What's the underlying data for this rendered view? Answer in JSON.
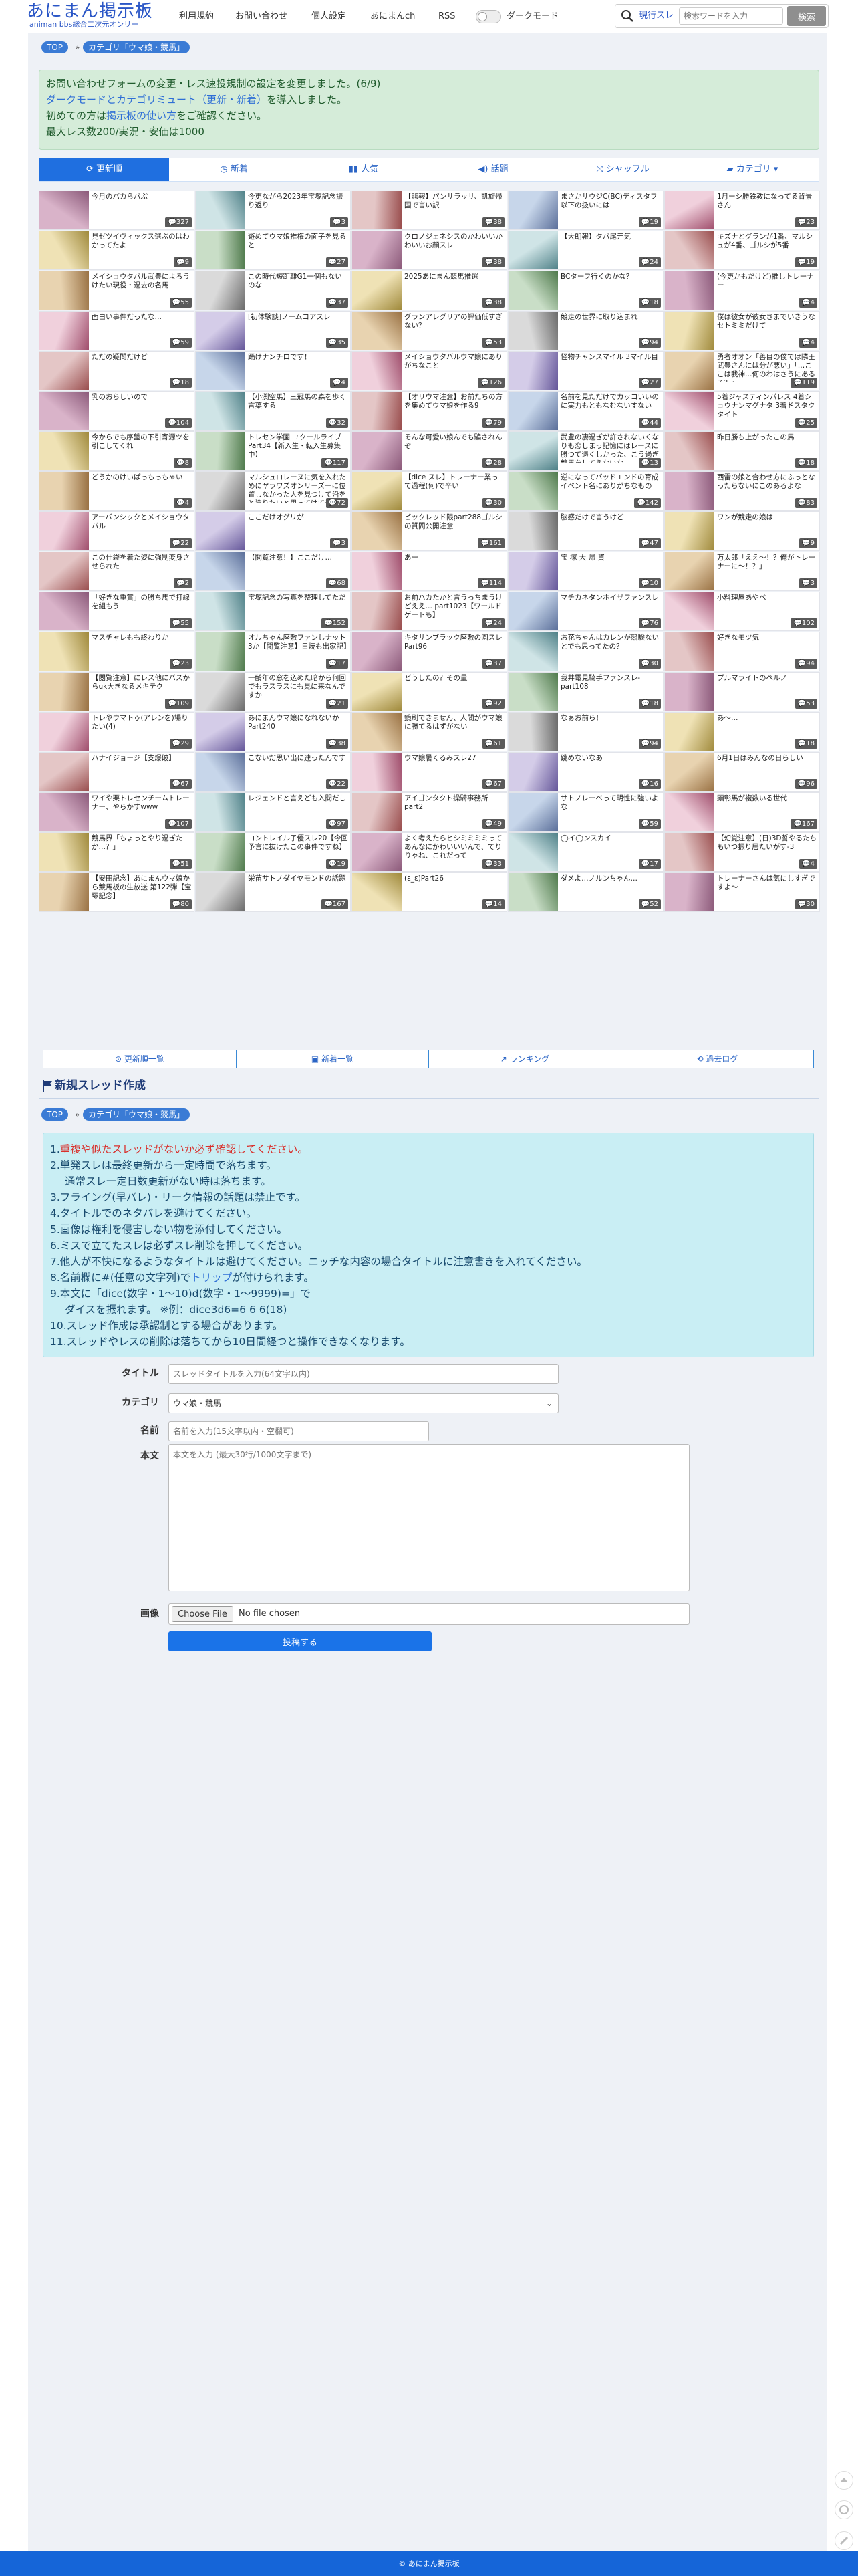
{
  "header": {
    "logo": "あにまん掲示板",
    "logo_sub": "animan bbs総合二次元オンリー",
    "nav": [
      "利用規約",
      "お問い合わせ",
      "個人設定",
      "あにまんch",
      "RSS"
    ],
    "dark_mode_label": "ダークモード",
    "search_mode": "現行スレ",
    "search_placeholder": "検索ワードを入力",
    "search_button": "検索"
  },
  "breadcrumb": {
    "top": "TOP",
    "category": "カテゴリ「ウマ娘・競馬」"
  },
  "notice": {
    "line1": "お問い合わせフォームの変更・レス速投規制の設定を変更しました。(6/9)",
    "line2_link": "ダークモードとカテゴリミュート（更新・新着）",
    "line2_tail": "を導入しました。",
    "line3_head": "初めての方は",
    "line3_link": "掲示板の使い方",
    "line3_tail": "をご確認ください。",
    "line4": "最大レス数200/実況・安価は1000"
  },
  "tabs": [
    "更新順",
    "新着",
    "人気",
    "話題",
    "シャッフル",
    "カテゴリ"
  ],
  "threads": [
    {
      "t": "今月のバカらバぷ",
      "n": "327"
    },
    {
      "t": "今更ながら2023年宝塚記念振り返り",
      "n": "3"
    },
    {
      "t": "【悲報】パンサラッサ、凱旋帰国で言い訳",
      "n": "38"
    },
    {
      "t": "まさかサウジC(BC)ディスタフ以下の扱いには",
      "n": "19"
    },
    {
      "t": "1月ーシ勝鉄教になってる背景さん",
      "n": "23"
    },
    {
      "t": "見ゼツイヴィックス選ぶのはわかってたよ",
      "n": "9"
    },
    {
      "t": "遊めてウマ娘推権の面子を見ると",
      "n": "27"
    },
    {
      "t": "クロノジェネシスのかわいいかわいいお顔スレ",
      "n": "38"
    },
    {
      "t": "【大朗報】タバ尾元気",
      "n": "24"
    },
    {
      "t": "キズナとグランが1番、マルシュが4番、ゴルシが5番",
      "n": "19"
    },
    {
      "t": "メイショウタバル武豊によろうけたい現役・過去の名馬",
      "n": "55"
    },
    {
      "t": "この時代短距離G1一個もないのな",
      "n": "37"
    },
    {
      "t": "2025あにまん競馬推選",
      "n": "38"
    },
    {
      "t": "BCターフ行くのかな？",
      "n": "18"
    },
    {
      "t": "(今更かもだけど)推しトレーナー",
      "n": "4"
    },
    {
      "t": "面白い事件だったな…",
      "n": "59"
    },
    {
      "t": "[初体験談]ノームコアスレ",
      "n": "35"
    },
    {
      "t": "グランアレグリアの評価低すぎない？",
      "n": "53"
    },
    {
      "t": "競走の世界に取り込まれ",
      "n": "94"
    },
    {
      "t": "僕は彼女が彼女さまでいきうなセトミミだけて",
      "n": "4"
    },
    {
      "t": "ただの疑問だけど",
      "n": "18"
    },
    {
      "t": "踊けナンチロです！",
      "n": "4"
    },
    {
      "t": "メイショウタバルウマ娘にありがちなこと",
      "n": "126"
    },
    {
      "t": "怪物チャンスマイル 3マイル目",
      "n": "27"
    },
    {
      "t": "勇者オオン「善目の僕では隣王武豊さんには分が悪い」「…ここは我神…何のわはさうにあるる？」",
      "n": "119"
    },
    {
      "t": "乳のおらしいので",
      "n": "104"
    },
    {
      "t": "【小渕空馬】三冠馬の森を歩く言葉する",
      "n": "32"
    },
    {
      "t": "【オリウマ注意】お前たちの方を集めてウマ娘を作る9",
      "n": "79"
    },
    {
      "t": "名前を見ただけでカッコいいのに実力もともなむないすない",
      "n": "44"
    },
    {
      "t": "5着ジャスティンパレス 4着ショウナンマグナタ 3着ドスタクタイト",
      "n": "25"
    },
    {
      "t": "今からでも序盤の下引寄源ツを引こしてくれ",
      "n": "8"
    },
    {
      "t": "トレセン学園 ユクールライブPart34【新入生・転入生募集中】",
      "n": "117"
    },
    {
      "t": "そんな可愛い娘んでも騙されんぞ",
      "n": "28"
    },
    {
      "t": "武豊の凄過ぎが許されないくなりも恋しまっ記憶にはレースに勝つて退くしかった、こう過ぎ競馬をしてえないな",
      "n": "13"
    },
    {
      "t": "昨日勝ち上がったこの馬",
      "n": "18"
    },
    {
      "t": "どうかのけいぱっちっちゃい",
      "n": "4"
    },
    {
      "t": "マルシュロレーヌに気を入れためにヤラワズオンリーズーに位置しなかった人を見つけて沿をと塗りたいと思ってけてきた",
      "n": "72"
    },
    {
      "t": "【dice スレ】トレーナー業って過程(何)で辛い",
      "n": "30"
    },
    {
      "t": "逆になってバッドエンドの育成イベント名にありがちなもの",
      "n": "142"
    },
    {
      "t": "西雷の娘と合わせ方にふっとなったらないにこのあるよな",
      "n": "83"
    },
    {
      "t": "アーバンシックとメイショウタバル",
      "n": "22"
    },
    {
      "t": "ここだけオグリが",
      "n": "3"
    },
    {
      "t": "ビックレッド限part288ゴルシの質問公開注意",
      "n": "161"
    },
    {
      "t": "脳感だけで言うけど",
      "n": "47"
    },
    {
      "t": "ワンが競走の娘は",
      "n": "9"
    },
    {
      "t": "この仕袋を着た姿に強制変身させられた",
      "n": "2"
    },
    {
      "t": "【閲覧注意！】ここだけ…",
      "n": "68"
    },
    {
      "t": "あー",
      "n": "114"
    },
    {
      "t": "宝 塚 大 帰 資",
      "n": "10"
    },
    {
      "t": "万太郎「ええ〜！？俺がトレーナーに〜！？」",
      "n": "3"
    },
    {
      "t": "「好きな重賞」の勝ち馬で打線を組もう",
      "n": "55"
    },
    {
      "t": "宝塚記念の写真を整理してただ",
      "n": "152"
    },
    {
      "t": "お前ハカたかと言うっちまうけどええ… part1023【ワールドゲートも】",
      "n": "24"
    },
    {
      "t": "マチカネタンホイザファンスレ",
      "n": "76"
    },
    {
      "t": "小料理屋あやべ",
      "n": "102"
    },
    {
      "t": "マスチャレもも終わりか",
      "n": "23"
    },
    {
      "t": "オルちゃん座敷ファンしナット 3か【閲覧注意】日焼も出家記】",
      "n": "17"
    },
    {
      "t": "キタサンブラック座敷の園スレPart96",
      "n": "37"
    },
    {
      "t": "お花ちゃんはカレンが競験ないとでも思ってたの？",
      "n": "30"
    },
    {
      "t": "好きなモツ気",
      "n": "94"
    },
    {
      "t": "【閲覧注意】にレス他にバスからuk大きなるメキテク",
      "n": "109"
    },
    {
      "t": "一齢年の窓を込めた暗から何回でもラスラスにも見に来なんですか",
      "n": "21"
    },
    {
      "t": "どうしたの？その量",
      "n": "92"
    },
    {
      "t": "我井電見騎手ファンスレ-part108",
      "n": "18"
    },
    {
      "t": "プルマライトのペルノ",
      "n": "53"
    },
    {
      "t": "トレやウマトゥ(アレンを)場りたい(4)",
      "n": "29"
    },
    {
      "t": "あにまんウマ娘になれないかPart240",
      "n": "38"
    },
    {
      "t": "鏡刷できません、人間がウマ娘に勝てるはずがない",
      "n": "61"
    },
    {
      "t": "なぁお前ら！",
      "n": "94"
    },
    {
      "t": "あ〜…",
      "n": "18"
    },
    {
      "t": "ハナイジョージ【支爆破】",
      "n": "67"
    },
    {
      "t": "こないだ思い出に連ったんです",
      "n": "22"
    },
    {
      "t": "ウマ娘暑くるみスレ27",
      "n": "67"
    },
    {
      "t": "跳めないなあ",
      "n": "16"
    },
    {
      "t": "6月1日はみんなの日らしい",
      "n": "96"
    },
    {
      "t": "ワイや栗トレセンチームトレーナー、やらかすwww",
      "n": "107"
    },
    {
      "t": "レジェンドと言えども入間だし",
      "n": "97"
    },
    {
      "t": "アイゴンタクト操騎事務所part2",
      "n": "49"
    },
    {
      "t": "サトノレーベって明性に強いよな",
      "n": "59"
    },
    {
      "t": "顕彰馬が複数いる世代",
      "n": "167"
    },
    {
      "t": "競馬界「ちょっとやり過ぎたか…？」",
      "n": "51"
    },
    {
      "t": "コントレイル子優スレ20【今回予言に抜けたこの事件ですね】",
      "n": "19"
    },
    {
      "t": "よく考えたらヒシミミミミってあんなにかわいいいんで、てりりゃね、これだって",
      "n": "33"
    },
    {
      "t": "◯イ◯ンスカイ",
      "n": "17"
    },
    {
      "t": "【幻覚注意】(日)3D誓やるたちもいつ振り居たいがす-3",
      "n": "4"
    },
    {
      "t": "【安田記念】あにまんウマ娘から競馬板の生放送 第122弾【宝塚記念】",
      "n": "80"
    },
    {
      "t": "栄苗サトノダイヤモンドの話題",
      "n": "167"
    },
    {
      "t": "(ε_ε)Part26",
      "n": "14"
    },
    {
      "t": "ダメよ…ノルンちゃん…",
      "n": "52"
    },
    {
      "t": "トレーナーさんは気にしすぎですよ〜",
      "n": "30"
    }
  ],
  "bottom_nav": [
    "更新順一覧",
    "新着一覧",
    "ランキング",
    "過去ログ"
  ],
  "section_title": "新規スレッド作成",
  "rules": [
    {
      "num": "1.",
      "red": "重複や似たスレッドがないか必ず確認してください。",
      "rest": ""
    },
    {
      "num": "2.",
      "red": "",
      "rest": "単発スレは最終更新から一定時間で落ちます。"
    },
    {
      "num": "",
      "red": "",
      "rest": "通常スレ一定日数更新がない時は落ちます。"
    },
    {
      "num": "3.",
      "red": "",
      "rest": "フライング(早バレ)・リーク情報の話題は禁止です。"
    },
    {
      "num": "4.",
      "red": "",
      "rest": "タイトルでのネタバレを避けてください。"
    },
    {
      "num": "5.",
      "red": "",
      "rest": "画像は権利を侵害しない物を添付してください。"
    },
    {
      "num": "6.",
      "red": "",
      "rest": "ミスで立てたスレは必ずスレ削除を押してください。"
    },
    {
      "num": "7.",
      "red": "",
      "rest": "他人が不快になるようなタイトルは避けてください。ニッチな内容の場合タイトルに注意書きを入れてください。"
    },
    {
      "num": "8.",
      "red": "",
      "rest": "名前欄に#(任意の文字列)で",
      "link": "トリップ",
      "tail": "が付けられます。"
    },
    {
      "num": "9.",
      "red": "",
      "rest": "本文に「dice(数字・1〜10)d(数字・1〜9999)=」で"
    },
    {
      "num": "",
      "red": "",
      "rest": "ダイスを振れます。 ※例：dice3d6=6 6 6(18)"
    },
    {
      "num": "10.",
      "red": "",
      "rest": "スレッド作成は承認制とする場合があります。"
    },
    {
      "num": "11.",
      "red": "",
      "rest": "スレッドやレスの削除は落ちてから10日間経つと操作できなくなります。"
    }
  ],
  "form": {
    "title_label": "タイトル",
    "title_placeholder": "スレッドタイトルを入力(64文字以内)",
    "category_label": "カテゴリ",
    "category_value": "ウマ娘・競馬",
    "name_label": "名前",
    "name_placeholder": "名前を入力(15文字以内・空欄可)",
    "body_label": "本文",
    "body_placeholder": "本文を入力 (最大30行/1000文字まで)",
    "image_label": "画像",
    "file_button": "Choose File",
    "file_text": "No file chosen",
    "submit": "投稿する"
  },
  "footer": "© あにまん掲示板",
  "colors": {
    "brand": "#2a56c6",
    "active_tab": "#1f6fe0",
    "footer": "#1565d8",
    "notice_bg": "#d5ecd9",
    "rules_bg": "#c9eef4",
    "red": "#d9302c"
  }
}
